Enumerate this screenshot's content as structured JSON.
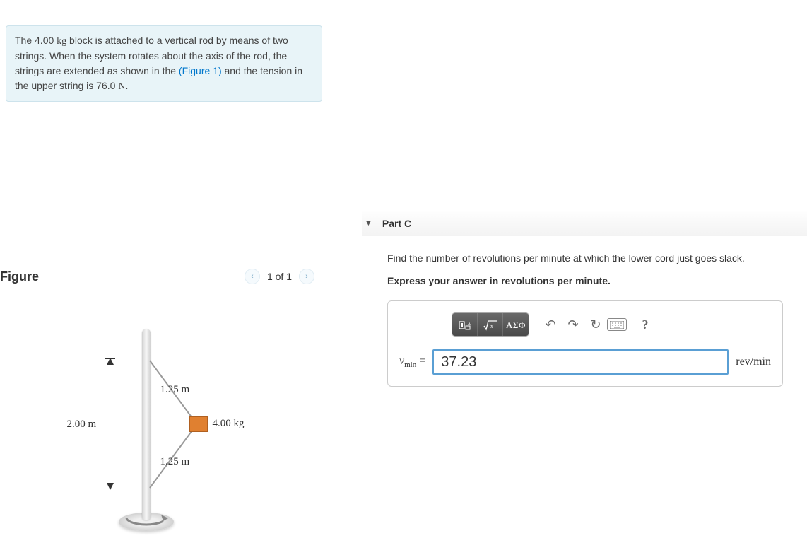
{
  "problem": {
    "mass": "4.00",
    "mass_unit": "kg",
    "line1a": "The ",
    "line1b": " block is attached to a vertical rod by means",
    "line2": "of two strings. When the system rotates about the axis of",
    "line3": "the rod, the strings are extended as shown in the",
    "figlink": "(Figure 1)",
    "line4": " and the tension in the upper string is ",
    "tension": "76.0",
    "tension_unit": "N",
    "period": "."
  },
  "figure": {
    "title": "Figure",
    "pager": "1 of 1",
    "height_label": "2.00 m",
    "string_label_top": "1.25 m",
    "string_label_bot": "1.25 m",
    "mass_label": "4.00 kg"
  },
  "part": {
    "header": "Part C",
    "question": "Find the number of revolutions per minute at which the lower cord just goes slack.",
    "instruction": "Express your answer in revolutions per minute.",
    "greek_btn": "ΑΣΦ",
    "help_btn": "?",
    "variable": "ν",
    "variable_sub": "min",
    "equals": " = ",
    "value": "37.23",
    "unit": "rev/min"
  }
}
